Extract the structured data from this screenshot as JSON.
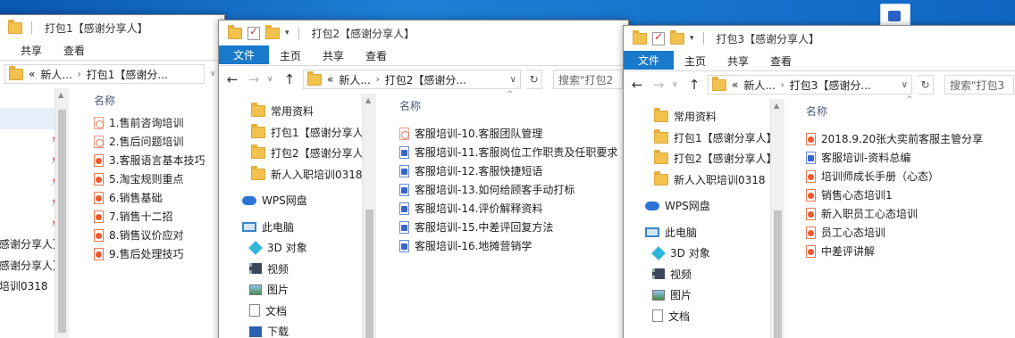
{
  "w1": {
    "title": "打包1【感谢分享人】",
    "ribbon": [
      "共享",
      "查看"
    ],
    "address": [
      "«",
      "新人...",
      "打包1【感谢分..."
    ],
    "column_name": "名称",
    "nav_items": [
      "",
      "",
      "",
      "",
      "",
      "",
      "感谢分享人】",
      "感谢分享人】",
      "培训0318"
    ],
    "files": [
      {
        "name": "1.售前咨询培训",
        "icon": "pdf-outline"
      },
      {
        "name": "2.售后问题培训",
        "icon": "pdf-outline"
      },
      {
        "name": "3.客服语言基本技巧",
        "icon": "pdf"
      },
      {
        "name": "5.淘宝规则重点",
        "icon": "pdf"
      },
      {
        "name": "6.销售基础",
        "icon": "pdf"
      },
      {
        "name": "7.销售十二招",
        "icon": "pdf"
      },
      {
        "name": "8.销售议价应对",
        "icon": "pdf"
      },
      {
        "name": "9.售后处理技巧",
        "icon": "pdf"
      }
    ]
  },
  "w2": {
    "title": "打包2【感谢分享人】",
    "ribbon": [
      "文件",
      "主页",
      "共享",
      "查看"
    ],
    "address": [
      "«",
      "新人...",
      "打包2【感谢分..."
    ],
    "search_placeholder": "搜索\"打包2",
    "column_name": "名称",
    "nav_items": [
      {
        "label": "常用资料",
        "icon": "folder-icon"
      },
      {
        "label": "打包1【感谢分享人】",
        "icon": "folder-icon"
      },
      {
        "label": "打包2【感谢分享人】",
        "icon": "folder-icon"
      },
      {
        "label": "新人入职培训0318",
        "icon": "folder-icon"
      },
      {
        "label": "",
        "icon": ""
      },
      {
        "label": "WPS网盘",
        "icon": "cloud-icon"
      },
      {
        "label": "",
        "icon": ""
      },
      {
        "label": "此电脑",
        "icon": "computer-icon"
      },
      {
        "label": "3D 对象",
        "icon": "3d-objects-icon"
      },
      {
        "label": "视频",
        "icon": "video-icon"
      },
      {
        "label": "图片",
        "icon": "pictures-icon"
      },
      {
        "label": "文档",
        "icon": "documents-icon"
      },
      {
        "label": "下载",
        "icon": "downloads-icon"
      }
    ],
    "files": [
      {
        "name": "客服培训-10.客服团队管理",
        "icon": "pdf-outline"
      },
      {
        "name": "客服培训-11.客服岗位工作职责及任职要求",
        "icon": "doc"
      },
      {
        "name": "客服培训-12.客服快捷短语",
        "icon": "doc"
      },
      {
        "name": "客服培训-13.如何给顾客手动打标",
        "icon": "doc"
      },
      {
        "name": "客服培训-14.评价解释资料",
        "icon": "doc"
      },
      {
        "name": "客服培训-15.中差评回复方法",
        "icon": "doc"
      },
      {
        "name": "客服培训-16.地摊营销学",
        "icon": "doc"
      }
    ]
  },
  "w3": {
    "title": "打包3【感谢分享人】",
    "ribbon": [
      "文件",
      "主页",
      "共享",
      "查看"
    ],
    "address": [
      "«",
      "新人...",
      "打包3【感谢分..."
    ],
    "search_placeholder": "搜索\"打包3",
    "column_name": "名称",
    "nav_items": [
      {
        "label": "常用资料",
        "icon": "folder-icon"
      },
      {
        "label": "打包1【感谢分享人】",
        "icon": "folder-icon"
      },
      {
        "label": "打包2【感谢分享人】",
        "icon": "folder-icon"
      },
      {
        "label": "新人入职培训0318",
        "icon": "folder-icon"
      },
      {
        "label": "",
        "icon": ""
      },
      {
        "label": "WPS网盘",
        "icon": "cloud-icon"
      },
      {
        "label": "",
        "icon": ""
      },
      {
        "label": "此电脑",
        "icon": "computer-icon"
      },
      {
        "label": "3D 对象",
        "icon": "3d-objects-icon"
      },
      {
        "label": "视频",
        "icon": "video-icon"
      },
      {
        "label": "图片",
        "icon": "pictures-icon"
      },
      {
        "label": "文档",
        "icon": "documents-icon"
      }
    ],
    "files": [
      {
        "name": "2018.9.20张大奕前客服主管分享",
        "icon": "pdf"
      },
      {
        "name": "客服培训-资料总编",
        "icon": "doc"
      },
      {
        "name": "培训师成长手册（心态）",
        "icon": "pdf"
      },
      {
        "name": "销售心态培训1",
        "icon": "pdf"
      },
      {
        "name": "新入职员工心态培训",
        "icon": "pdf"
      },
      {
        "name": "员工心态培训",
        "icon": "pdf"
      },
      {
        "name": "中差评讲解",
        "icon": "pdf"
      }
    ]
  },
  "colors": {
    "accent": "#1979ca",
    "desktop": "#1a73c9",
    "folder": "#f2c14e"
  }
}
